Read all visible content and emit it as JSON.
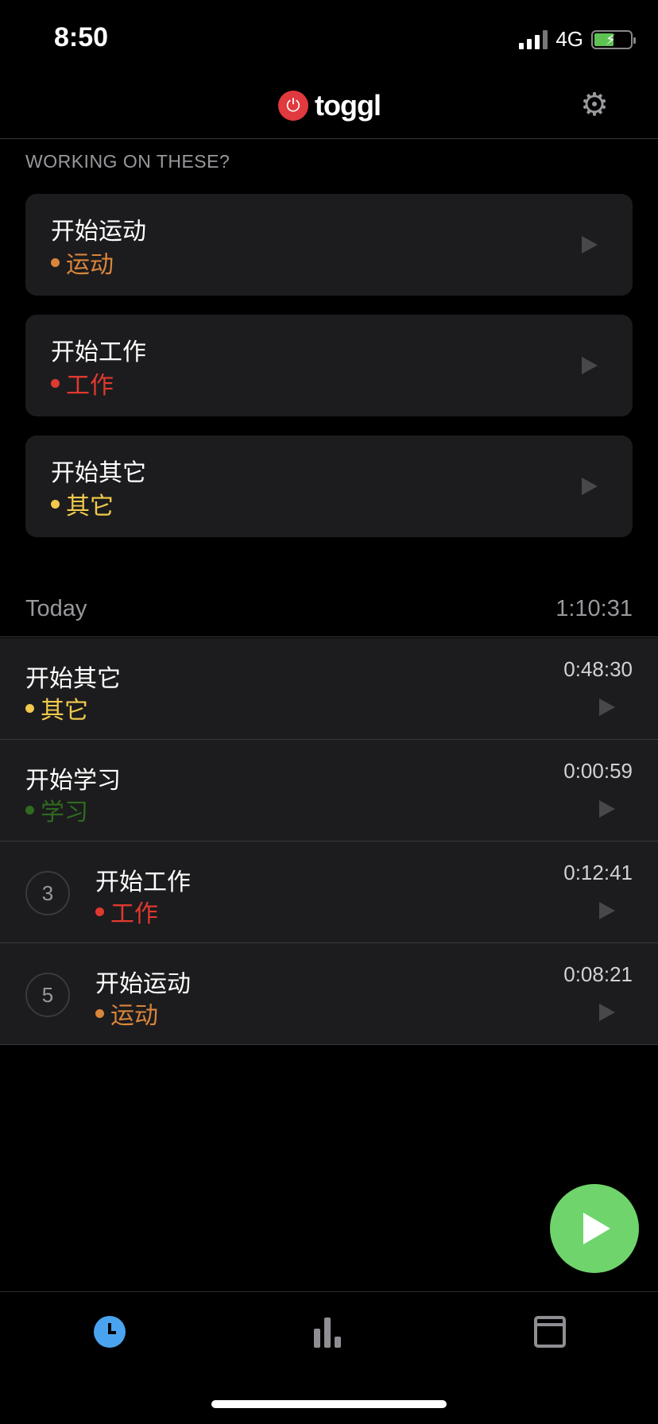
{
  "status_bar": {
    "time": "8:50",
    "network": "4G"
  },
  "header": {
    "logo_text": "toggl",
    "logo_icon": "power-icon",
    "settings_icon": "gear-icon"
  },
  "suggestions": {
    "label": "WORKING ON THESE?",
    "items": [
      {
        "title": "开始运动",
        "project": "运动",
        "color": "#d9853b"
      },
      {
        "title": "开始工作",
        "project": "工作",
        "color": "#e0392f"
      },
      {
        "title": "开始其它",
        "project": "其它",
        "color": "#f2c94c"
      }
    ]
  },
  "today": {
    "label": "Today",
    "total": "1:10:31",
    "entries": [
      {
        "title": "开始其它",
        "project": "其它",
        "color": "#f2c94c",
        "duration": "0:48:30",
        "count": ""
      },
      {
        "title": "开始学习",
        "project": "学习",
        "color": "#2e6b1f",
        "duration": "0:00:59",
        "count": ""
      },
      {
        "title": "开始工作",
        "project": "工作",
        "color": "#e0392f",
        "duration": "0:12:41",
        "count": "3"
      },
      {
        "title": "开始运动",
        "project": "运动",
        "color": "#d9853b",
        "duration": "0:08:21",
        "count": "5"
      }
    ]
  },
  "fab": {
    "icon": "play-icon",
    "color": "#6fd46b"
  },
  "tab_bar": {
    "tabs": [
      {
        "name": "timer",
        "icon": "clock-icon",
        "active": true
      },
      {
        "name": "reports",
        "icon": "bar-chart-icon",
        "active": false
      },
      {
        "name": "calendar",
        "icon": "calendar-icon",
        "active": false
      }
    ]
  }
}
